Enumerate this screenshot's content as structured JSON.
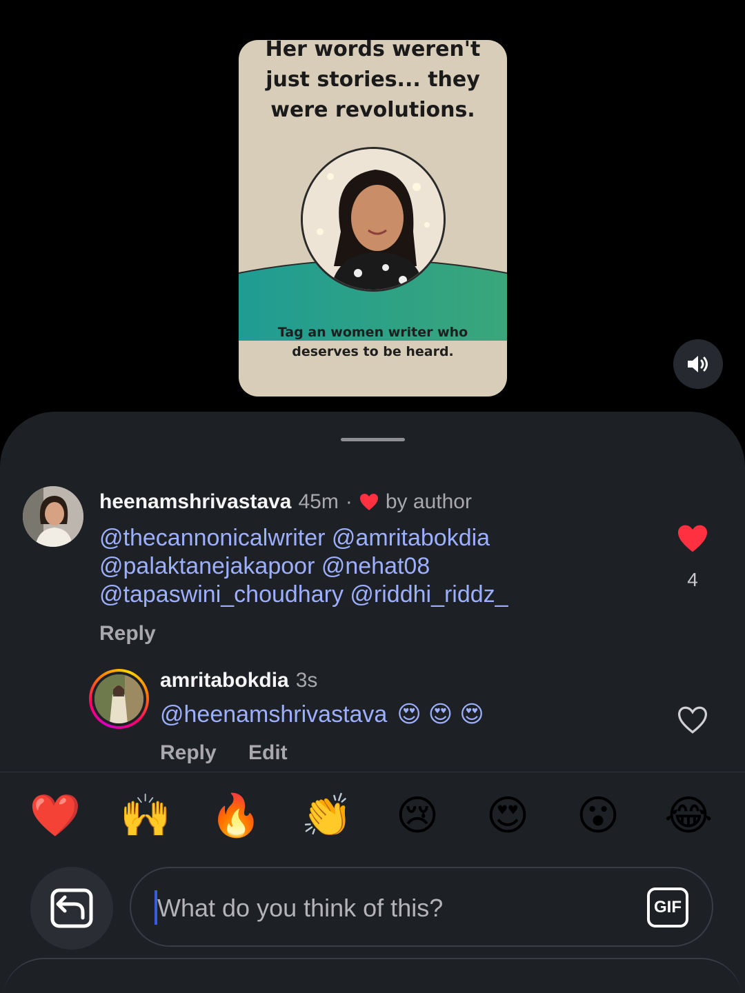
{
  "reel": {
    "headline_lines": [
      "Her words weren't",
      "just stories... they",
      "were revolutions."
    ],
    "caption_lines": [
      "Tag an women writer who",
      "deserves to be heard."
    ]
  },
  "comments": [
    {
      "username": "heenamshrivastava",
      "time": "45m",
      "separator": "·",
      "liked_by_author_label": "by author",
      "mention_lines": [
        "@thecannonicalwriter @amritabokdia",
        "@palaktanejakapoor @nehat08",
        "@tapaswini_choudhary @riddhi_riddz_"
      ],
      "reply_label": "Reply",
      "like_count": "4"
    },
    {
      "username": "amritabokdia",
      "time": "3s",
      "mention": "@heenamshrivastava",
      "emojis": [
        "😍",
        "😍",
        "😍"
      ],
      "reply_label": "Reply",
      "edit_label": "Edit"
    }
  ],
  "quick_reactions": [
    "❤️",
    "🙌",
    "🔥",
    "👏",
    "😢",
    "😍",
    "😮",
    "😂"
  ],
  "composer": {
    "placeholder": "What do you think of this?",
    "gif_label": "GIF"
  },
  "colors": {
    "mention_blue": "#9db0ff",
    "like_red": "#ff3040",
    "sheet_bg": "#1d2025"
  }
}
